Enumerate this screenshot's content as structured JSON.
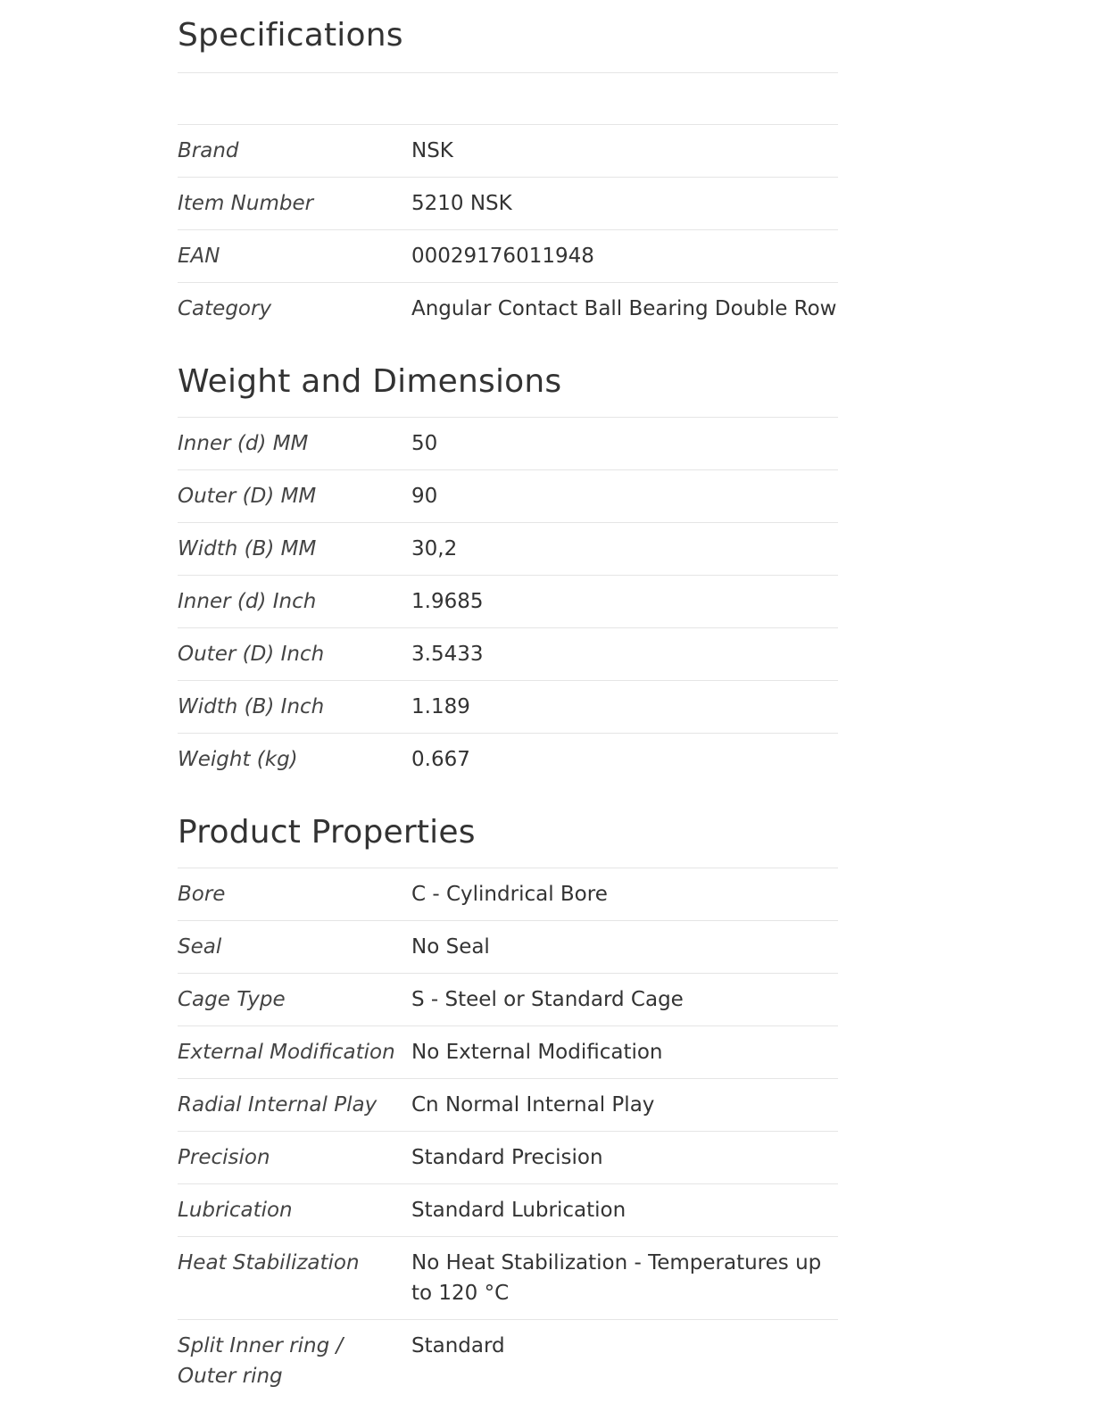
{
  "sections": [
    {
      "title": "Specifications",
      "rows": [
        {
          "label": "Brand",
          "value": "NSK"
        },
        {
          "label": "Item Number",
          "value": "5210 NSK"
        },
        {
          "label": "EAN",
          "value": "00029176011948"
        },
        {
          "label": "Category",
          "value": "Angular Contact Ball Bearing Double Row"
        }
      ]
    },
    {
      "title": "Weight and Dimensions",
      "rows": [
        {
          "label": "Inner (d) MM",
          "value": "50"
        },
        {
          "label": "Outer (D) MM",
          "value": "90"
        },
        {
          "label": "Width (B) MM",
          "value": "30,2"
        },
        {
          "label": "Inner (d) Inch",
          "value": "1.9685"
        },
        {
          "label": "Outer (D) Inch",
          "value": "3.5433"
        },
        {
          "label": "Width (B) Inch",
          "value": "1.189"
        },
        {
          "label": "Weight (kg)",
          "value": "0.667"
        }
      ]
    },
    {
      "title": "Product Properties",
      "rows": [
        {
          "label": "Bore",
          "value": "C - Cylindrical Bore"
        },
        {
          "label": "Seal",
          "value": "No Seal"
        },
        {
          "label": "Cage Type",
          "value": "S - Steel or Standard Cage"
        },
        {
          "label": "External Modification",
          "value": "No External Modification"
        },
        {
          "label": "Radial Internal Play",
          "value": "Cn Normal Internal Play"
        },
        {
          "label": "Precision",
          "value": "Standard Precision"
        },
        {
          "label": "Lubrication",
          "value": "Standard Lubrication"
        },
        {
          "label": "Heat Stabilization",
          "value": "No Heat Stabilization - Temperatures up to 120 °C"
        },
        {
          "label": "Split Inner ring / Outer ring",
          "value": "Standard"
        }
      ]
    }
  ]
}
